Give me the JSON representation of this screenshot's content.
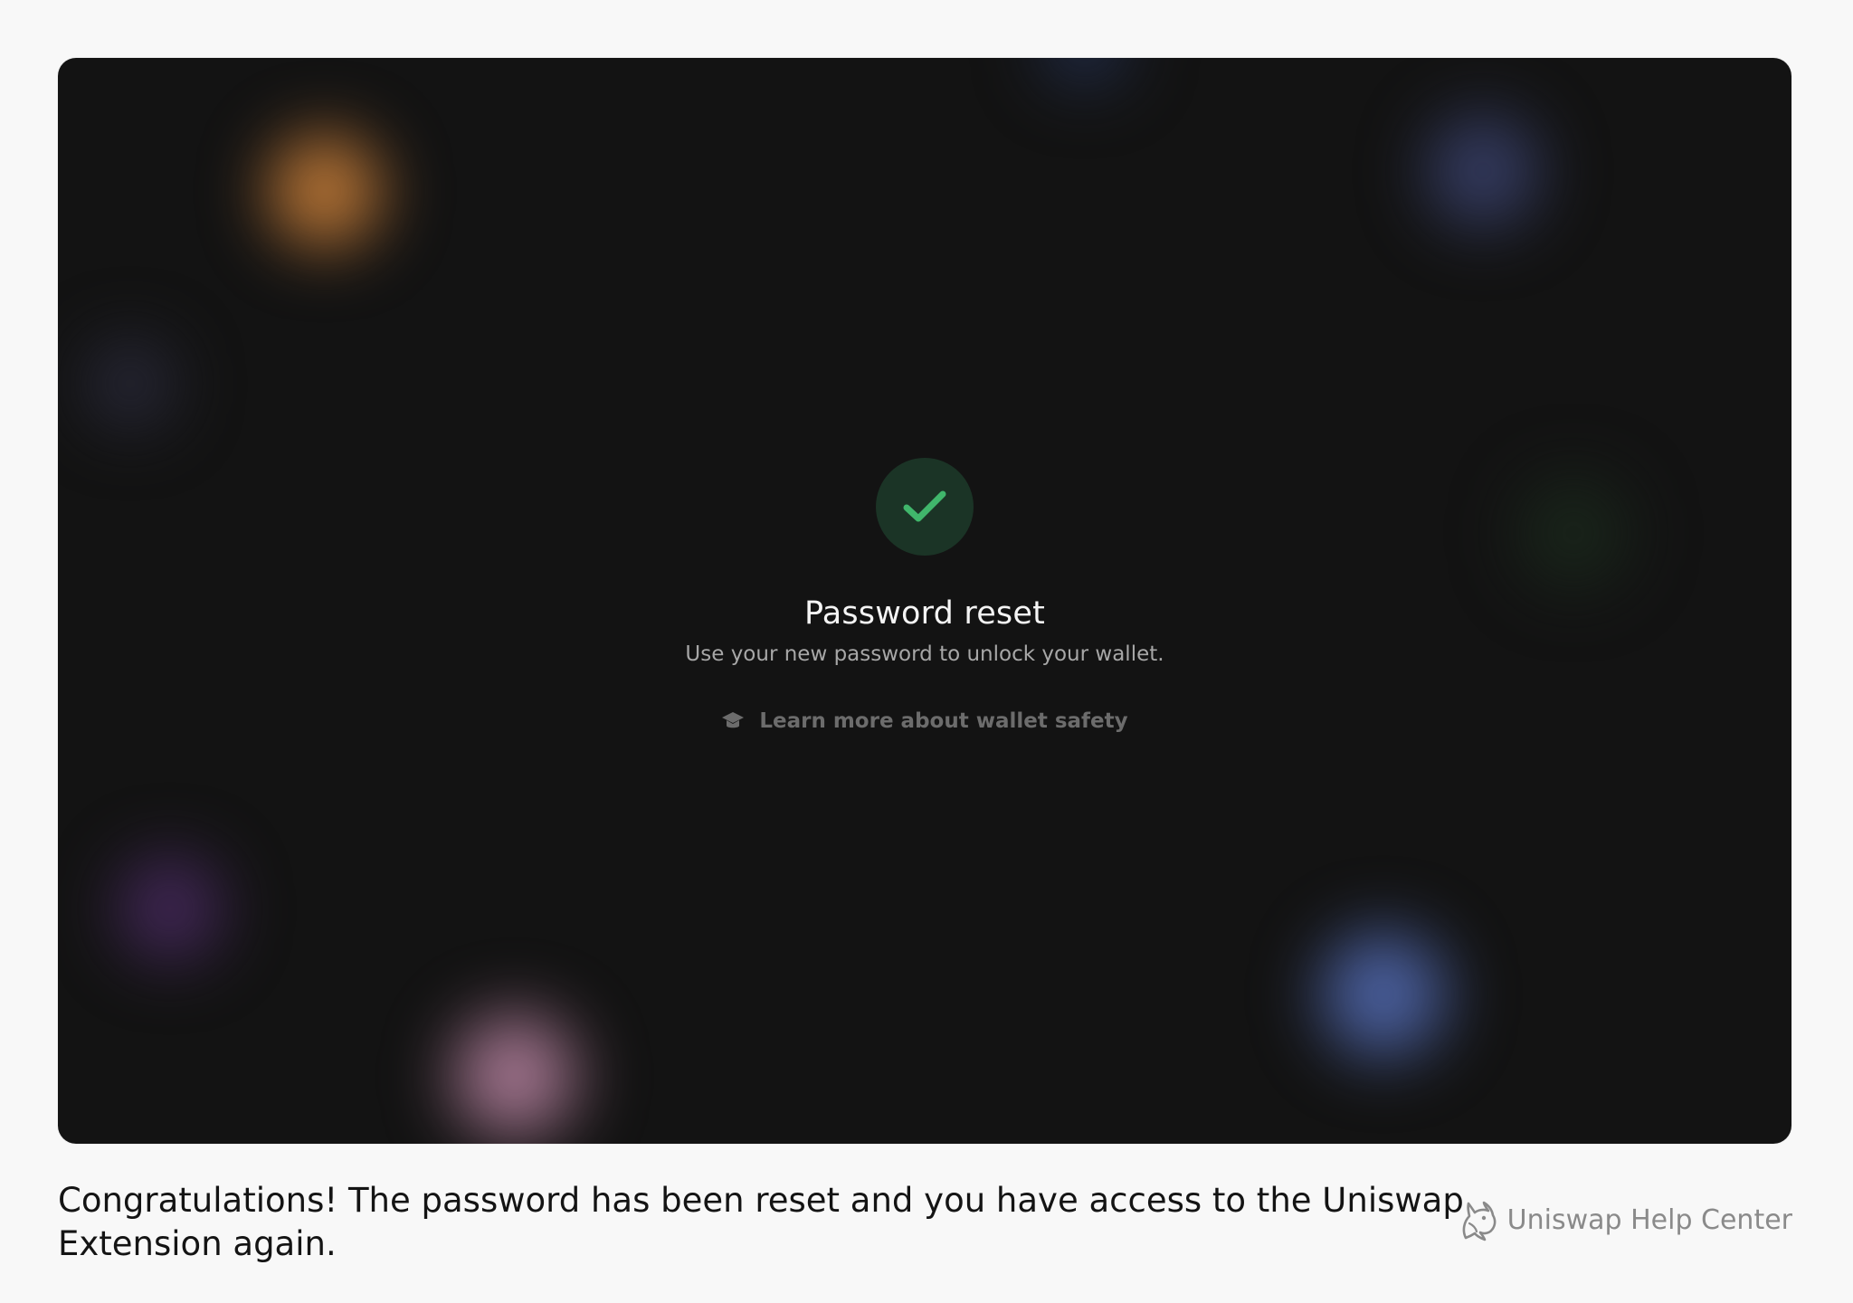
{
  "screen": {
    "title": "Password reset",
    "subtitle": "Use your new password to unlock your wallet.",
    "learn_more_link": "Learn more about wallet safety",
    "success_color": "#40b66b"
  },
  "footer": {
    "caption": "Congratulations! The password has been reset and you have access to the Uniswap Extension again.",
    "brand_label": "Uniswap Help Center"
  },
  "icons": {
    "success": "checkmark-icon",
    "learn": "graduation-cap-icon",
    "brand": "uniswap-unicorn-icon"
  }
}
